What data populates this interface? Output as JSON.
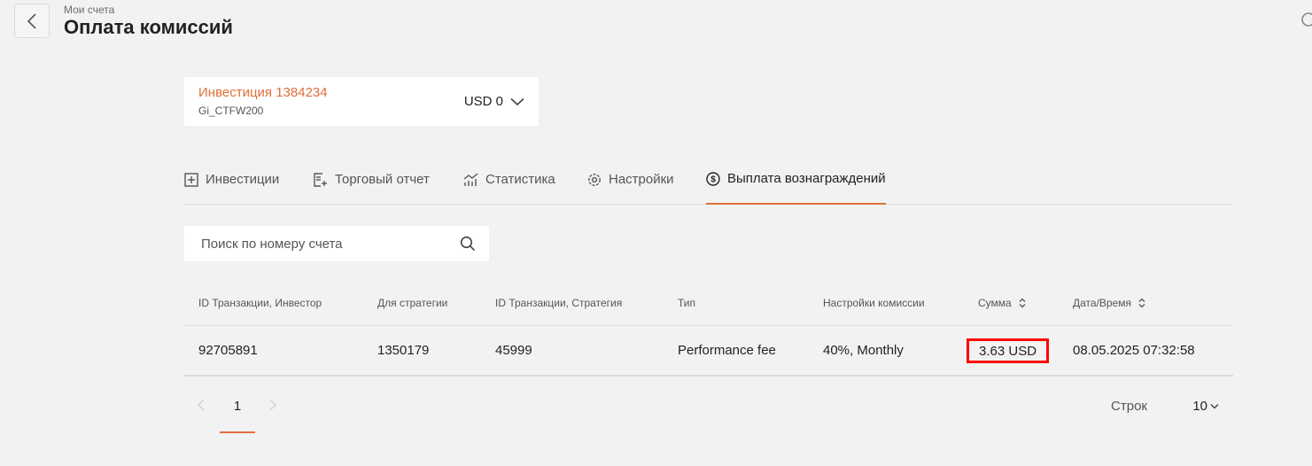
{
  "header": {
    "breadcrumb": "Мои счета",
    "title": "Оплата комиссий"
  },
  "account": {
    "name": "Инвестиция 1384234",
    "strategy": "Gi_CTFW200",
    "balance": "USD 0"
  },
  "tabs": [
    {
      "label": "Инвестиции",
      "icon": "plus-square-icon"
    },
    {
      "label": "Торговый отчет",
      "icon": "report-add-icon"
    },
    {
      "label": "Статистика",
      "icon": "chart-trend-icon"
    },
    {
      "label": "Настройки",
      "icon": "gear-icon"
    },
    {
      "label": "Выплата вознаграждений",
      "icon": "dollar-circle-icon",
      "active": true
    }
  ],
  "search": {
    "placeholder": "Поиск по номеру счета",
    "value": ""
  },
  "table": {
    "columns": [
      "ID Транзакции, Инвестор",
      "Для стратегии",
      "ID Транзакции, Стратегия",
      "Тип",
      "Настройки комиссии",
      "Сумма",
      "Дата/Время"
    ],
    "rows": [
      {
        "investor_tx": "92705891",
        "strategy": "1350179",
        "strategy_tx": "45999",
        "type": "Performance fee",
        "fee_settings": "40%, Monthly",
        "amount": "3.63 USD",
        "datetime": "08.05.2025 07:32:58"
      }
    ]
  },
  "pagination": {
    "current_page": "1",
    "rows_label": "Строк",
    "rows_value": "10"
  },
  "colors": {
    "accent": "#e0703a",
    "highlight": "#ff0000"
  }
}
